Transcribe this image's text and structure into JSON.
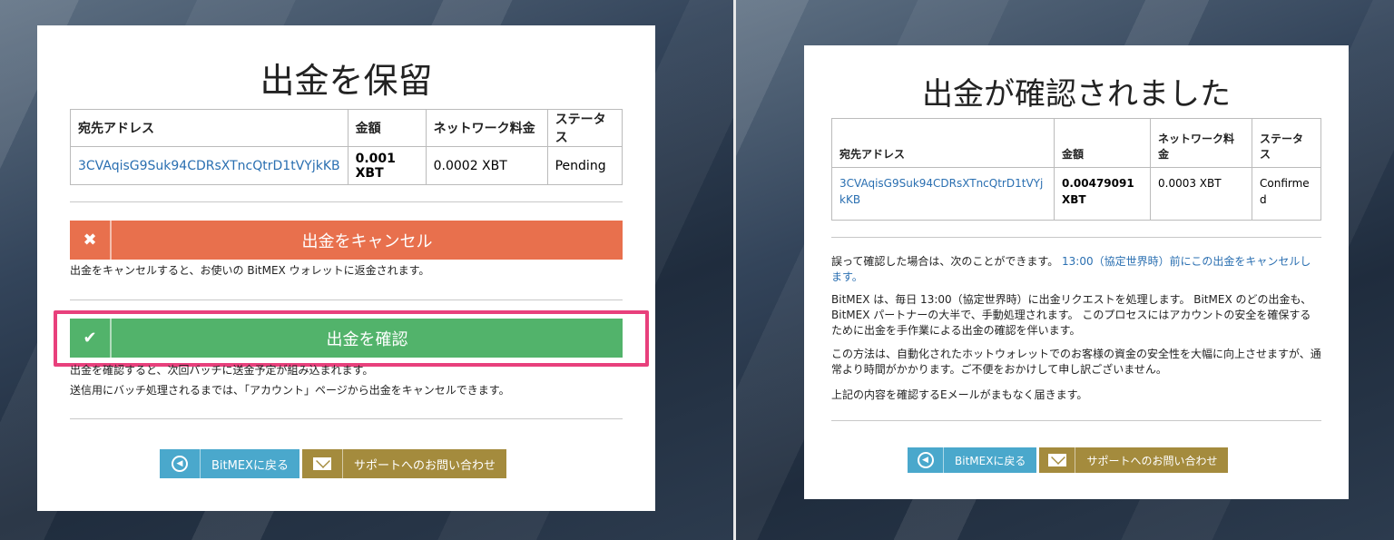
{
  "left": {
    "title": "出金を保留",
    "table": {
      "headers": [
        "宛先アドレス",
        "金額",
        "ネットワーク料金",
        "ステータス"
      ],
      "row": {
        "address": "3CVAqisG9Suk94CDRsXTncQtrD1tVYjkKB",
        "amount": "0.001 XBT",
        "fee": "0.0002 XBT",
        "status": "Pending"
      }
    },
    "cancel_button": "出金をキャンセル",
    "cancel_note": "出金をキャンセルすると、お使いの BitMEX ウォレットに返金されます。",
    "confirm_button": "出金を確認",
    "confirm_note_1": "出金を確認すると、次回バッチに送金予定が組み込まれます。",
    "confirm_note_2": "送信用にバッチ処理されるまでは、「アカウント」ページから出金をキャンセルできます。",
    "back_button": "BitMEXに戻る",
    "support_button": "サポートへのお問い合わせ"
  },
  "right": {
    "title": "出金が確認されました",
    "table": {
      "headers": [
        "宛先アドレス",
        "金額",
        "ネットワーク料金",
        "ステータス"
      ],
      "row": {
        "address": "3CVAqisG9Suk94CDRsXTncQtrD1tVYjkKB",
        "amount": "0.00479091 XBT",
        "fee": "0.0003 XBT",
        "status": "Confirmed"
      }
    },
    "para1_text": "誤って確認した場合は、次のことができます。",
    "para1_link": "13:00（協定世界時）前にこの出金をキャンセルします。",
    "para2": "BitMEX は、毎日 13:00（協定世界時）に出金リクエストを処理します。 BitMEX のどの出金も、BitMEX パートナーの大半で、手動処理されます。 このプロセスにはアカウントの安全を確保するために出金を手作業による出金の確認を伴います。",
    "para3": "この方法は、自動化されたホットウォレットでのお客様の資金の安全性を大幅に向上させますが、通常より時間がかかります。ご不便をおかけして申し訳ございません。",
    "para4": "上記の内容を確認するEメールがまもなく届きます。",
    "back_button": "BitMEXに戻る",
    "support_button": "サポートへのお問い合わせ"
  },
  "colors": {
    "cancel": "#e8704d",
    "confirm": "#52b36b",
    "highlight": "#e8407c",
    "back": "#4aa8cc",
    "support": "#a48b3d",
    "link": "#2a6fb1"
  },
  "icons": {
    "cancel": "close-icon",
    "confirm": "check-icon",
    "back": "back-arrow-icon",
    "support": "envelope-icon"
  }
}
